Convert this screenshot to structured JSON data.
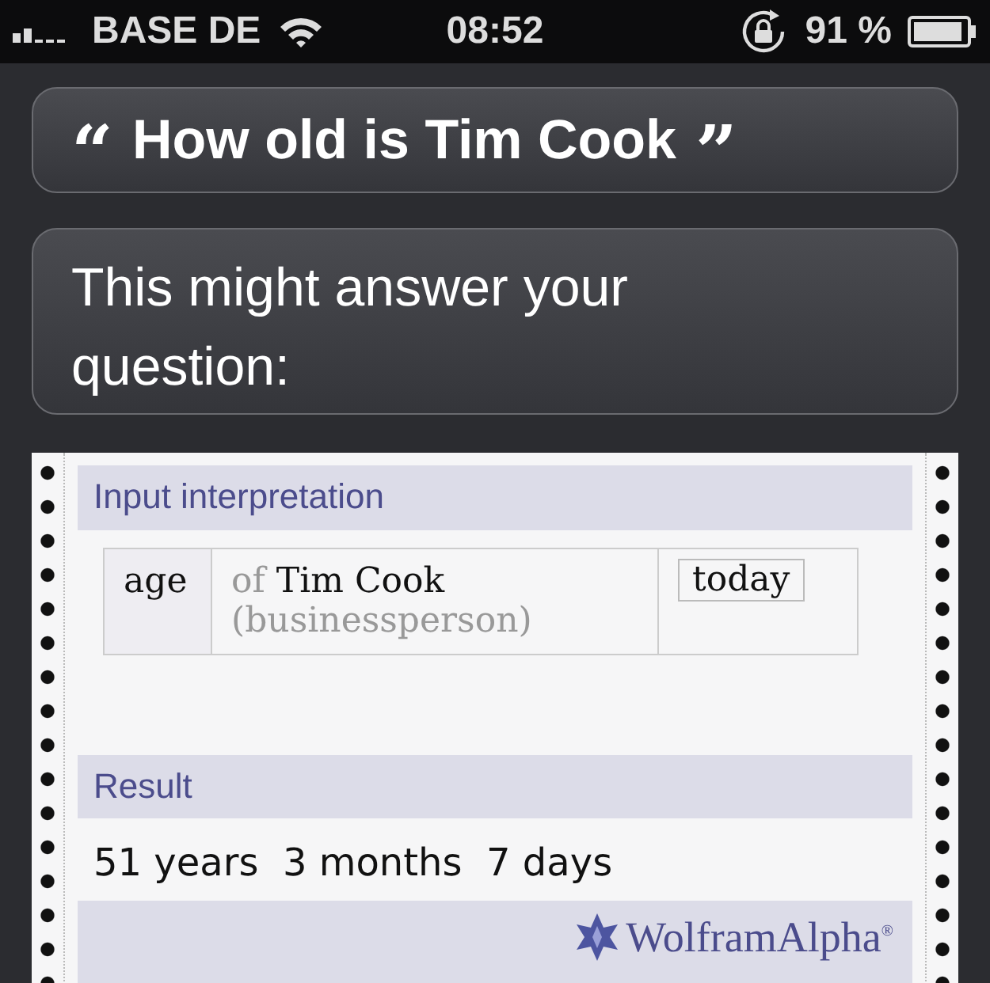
{
  "status_bar": {
    "carrier": "BASE DE",
    "time": "08:52",
    "battery": "91 %"
  },
  "query": {
    "open_quote": "“",
    "text": "How old is Tim Cook",
    "close_quote": "”"
  },
  "reply": "This might answer your question:",
  "result_card": {
    "input_header": "Input interpretation",
    "input_cells": [
      {
        "kind": "property",
        "text": "age"
      },
      {
        "kind": "subject",
        "prefix": "of",
        "name": "Tim Cook",
        "note": "(businessperson)"
      },
      {
        "kind": "date",
        "text": "today"
      }
    ],
    "result_header": "Result",
    "result": "51 years  3 months  7 days",
    "brand": "WolframAlpha$^{®}$"
  }
}
